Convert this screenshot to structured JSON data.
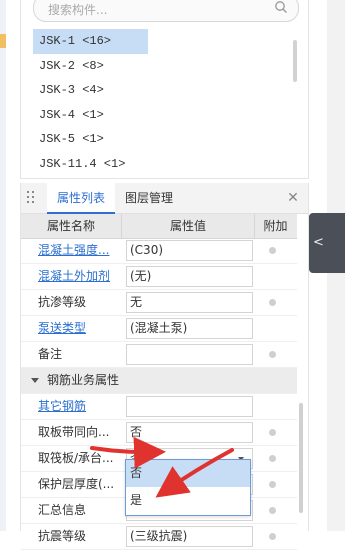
{
  "search": {
    "placeholder": "搜索构件..."
  },
  "components": [
    "JSK-1 <16>",
    "JSK-2 <8>",
    "JSK-3 <4>",
    "JSK-4 <1>",
    "JSK-5 <1>",
    "JSK-11.4 <1>"
  ],
  "selected_component_index": 0,
  "tabs": {
    "active": "属性列表",
    "inactive": "图层管理"
  },
  "columns": {
    "name": "属性名称",
    "value": "属性值",
    "extra": "附加"
  },
  "rows": [
    {
      "name": "混凝土强度...",
      "value": "(C30)",
      "link": true,
      "has_dot": true
    },
    {
      "name": "混凝土外加剂",
      "value": "(无)",
      "link": true,
      "has_dot": false
    },
    {
      "name": "抗渗等级",
      "value": "无",
      "link": false,
      "has_dot": true
    },
    {
      "name": "泵送类型",
      "value": "(混凝土泵)",
      "link": true,
      "has_dot": false
    },
    {
      "name": "备注",
      "value": "",
      "link": false,
      "has_dot": true
    }
  ],
  "group": {
    "label": "钢筋业务属性"
  },
  "group_rows": [
    {
      "name": "其它钢筋",
      "value": "",
      "link": true,
      "has_dot": false
    },
    {
      "name": "取板带同向...",
      "value": "否",
      "link": false,
      "has_dot": true
    },
    {
      "name": "取筏板/承台...",
      "value": "否",
      "link": false,
      "has_dot": true
    },
    {
      "name": "保护层厚度(...",
      "value": "",
      "link": false,
      "has_dot": true
    },
    {
      "name": "汇总信息",
      "value": "",
      "link": false,
      "has_dot": true
    },
    {
      "name": "抗震等级",
      "value": "(三级抗震)",
      "link": false,
      "has_dot": true
    }
  ],
  "dropdown": {
    "options": [
      "否",
      "是"
    ],
    "highlighted": "否"
  },
  "annotation_color": "#e0332f"
}
